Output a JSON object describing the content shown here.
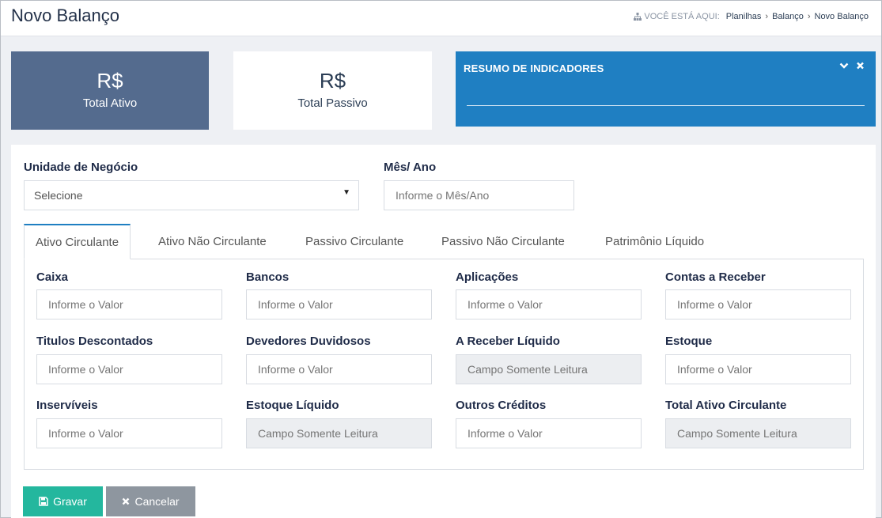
{
  "header": {
    "title": "Novo Balanço",
    "breadcrumb_prefix": "VOCÊ ESTÁ AQUI:",
    "breadcrumb": [
      "Planilhas",
      "Balanço",
      "Novo Balanço"
    ]
  },
  "cards": {
    "ativo": {
      "currency": "R$",
      "label": "Total Ativo"
    },
    "passivo": {
      "currency": "R$",
      "label": "Total Passivo"
    },
    "resumo": {
      "title": "RESUMO DE INDICADORES"
    }
  },
  "form": {
    "unidade_label": "Unidade de Negócio",
    "unidade_value": "Selecione",
    "mes_label": "Mês/ Ano",
    "mes_placeholder": "Informe o Mês/Ano"
  },
  "tabs": [
    {
      "label": "Ativo Circulante",
      "active": true
    },
    {
      "label": "Ativo Não Circulante",
      "active": false
    },
    {
      "label": "Passivo Circulante",
      "active": false
    },
    {
      "label": "Passivo Não Circulante",
      "active": false
    },
    {
      "label": "Patrimônio Líquido",
      "active": false
    }
  ],
  "fields": [
    {
      "label": "Caixa",
      "placeholder": "Informe o Valor",
      "readonly": false
    },
    {
      "label": "Bancos",
      "placeholder": "Informe o Valor",
      "readonly": false
    },
    {
      "label": "Aplicações",
      "placeholder": "Informe o Valor",
      "readonly": false
    },
    {
      "label": "Contas a Receber",
      "placeholder": "Informe o Valor",
      "readonly": false
    },
    {
      "label": "Titulos Descontados",
      "placeholder": "Informe o Valor",
      "readonly": false
    },
    {
      "label": "Devedores Duvidosos",
      "placeholder": "Informe o Valor",
      "readonly": false
    },
    {
      "label": "A Receber Líquido",
      "placeholder": "Campo Somente Leitura",
      "readonly": true
    },
    {
      "label": "Estoque",
      "placeholder": "Informe o Valor",
      "readonly": false
    },
    {
      "label": "Inservíveis",
      "placeholder": "Informe o Valor",
      "readonly": false
    },
    {
      "label": "Estoque Líquido",
      "placeholder": "Campo Somente Leitura",
      "readonly": true
    },
    {
      "label": "Outros Créditos",
      "placeholder": "Informe o Valor",
      "readonly": false
    },
    {
      "label": "Total Ativo Circulante",
      "placeholder": "Campo Somente Leitura",
      "readonly": true
    }
  ],
  "buttons": {
    "gravar": "Gravar",
    "cancelar": "Cancelar"
  },
  "icons": {
    "breadcrumb": "sitemap-icon",
    "gravar": "floppy-disk-icon",
    "cancelar": "close-icon",
    "collapse": "chevron-down-icon",
    "close": "close-icon",
    "select": "caret-down-icon"
  },
  "colors": {
    "primary": "#1f7fc2",
    "card_ativo": "#546b8e",
    "success": "#24b79e",
    "secondary": "#8e969f",
    "title": "#24324a"
  }
}
